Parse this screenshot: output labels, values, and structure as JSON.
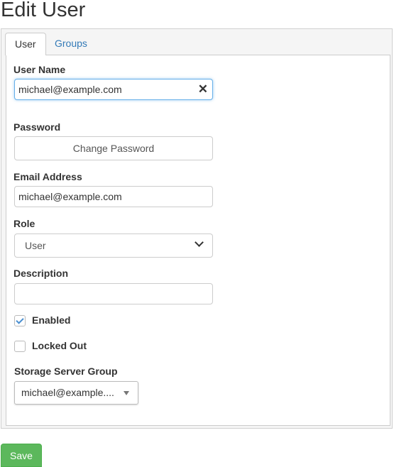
{
  "page": {
    "title": "Edit User"
  },
  "tabs": [
    {
      "label": "User",
      "active": true
    },
    {
      "label": "Groups",
      "active": false
    }
  ],
  "form": {
    "username": {
      "label": "User Name",
      "value": "michael@example.com",
      "clear_icon": "close-icon"
    },
    "password": {
      "label": "Password",
      "button": "Change Password"
    },
    "email": {
      "label": "Email Address",
      "value": "michael@example.com"
    },
    "role": {
      "label": "Role",
      "selected": "User",
      "icon": "chevron-down-icon"
    },
    "description": {
      "label": "Description",
      "value": ""
    },
    "enabled": {
      "label": "Enabled",
      "checked": true
    },
    "locked_out": {
      "label": "Locked Out",
      "checked": false
    },
    "storage_group": {
      "label": "Storage Server Group",
      "selected": "michael@example...."
    }
  },
  "actions": {
    "save": "Save"
  },
  "colors": {
    "link": "#337ab7",
    "save": "#5cb85c",
    "focus": "#66afe9"
  }
}
